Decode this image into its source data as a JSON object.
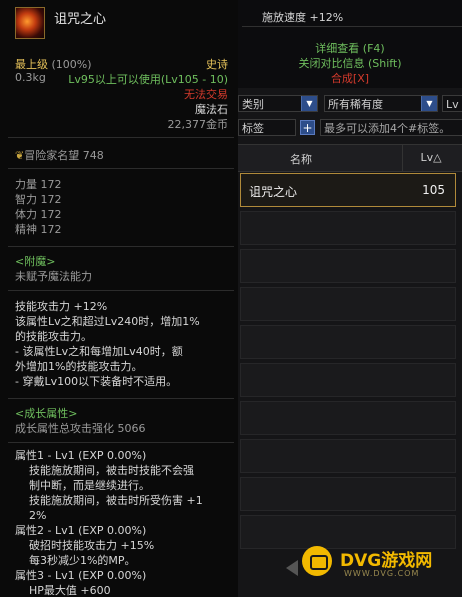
{
  "tooltip": {
    "item_name": "诅咒之心",
    "grade": "最上级",
    "grade_pct": "(100%)",
    "rarity": "史诗",
    "weight": "0.3kg",
    "req_level": "Lv95以上可以使用(Lv105 - 10)",
    "untradeable": "无法交易",
    "item_type": "魔法石",
    "price": "22,377金币",
    "fame_label": "冒险家名望",
    "fame_value": "748",
    "stats": [
      {
        "label": "力量",
        "value": "172"
      },
      {
        "label": "智力",
        "value": "172"
      },
      {
        "label": "体力",
        "value": "172"
      },
      {
        "label": "精神",
        "value": "172"
      }
    ],
    "enchant_title": "<附魔>",
    "enchant_text": "未赋予魔法能力",
    "skill_lines": [
      "技能攻击力 +12%",
      "该属性Lv之和超过Lv240时，增加1%",
      "的技能攻击力。",
      "- 该属性Lv之和每增加Lv40时，额",
      "外增加1%的技能攻击力。",
      "- 穿戴Lv100以下装备时不适用。"
    ],
    "growth_title": "<成长属性>",
    "growth_total_label": "成长属性总攻击强化",
    "growth_total_value": "5066",
    "growth_lines": [
      "属性1 - Lv1 (EXP 0.00%)",
      "    技能施放期间，被击时技能不会强",
      "    制中断，而是继续进行。",
      "    技能施放期间，被击时所受伤害 +1",
      "    2%",
      "属性2 - Lv1 (EXP 0.00%)",
      "    破招时技能攻击力 +15%",
      "    每3秒减少1%的MP。",
      "属性3 - Lv1 (EXP 0.00%)",
      "    HP最大值 +600"
    ]
  },
  "panel": {
    "speed_line": "施放速度 +12%",
    "detail_link": "详细查看 (F4)",
    "compare_link": "关闭对比信息 (Shift)",
    "synth_link": "合成[X]",
    "filter_category": "类别",
    "filter_rarity": "所有稀有度",
    "filter_level": "Lv",
    "tag_label": "标签",
    "tag_placeholder": "最多可以添加4个#标签。",
    "col_name": "名称",
    "col_lv": "Lv△",
    "items": [
      {
        "name": "诅咒之心",
        "lv": "105"
      }
    ]
  },
  "watermark": {
    "text": "DVG游戏网",
    "url": "WWW.DVG.COM"
  },
  "colors": {
    "gold": "#e6c25a",
    "green": "#6fbf5e",
    "red": "#d33a2c",
    "select_blue": "#2d4d8a"
  }
}
